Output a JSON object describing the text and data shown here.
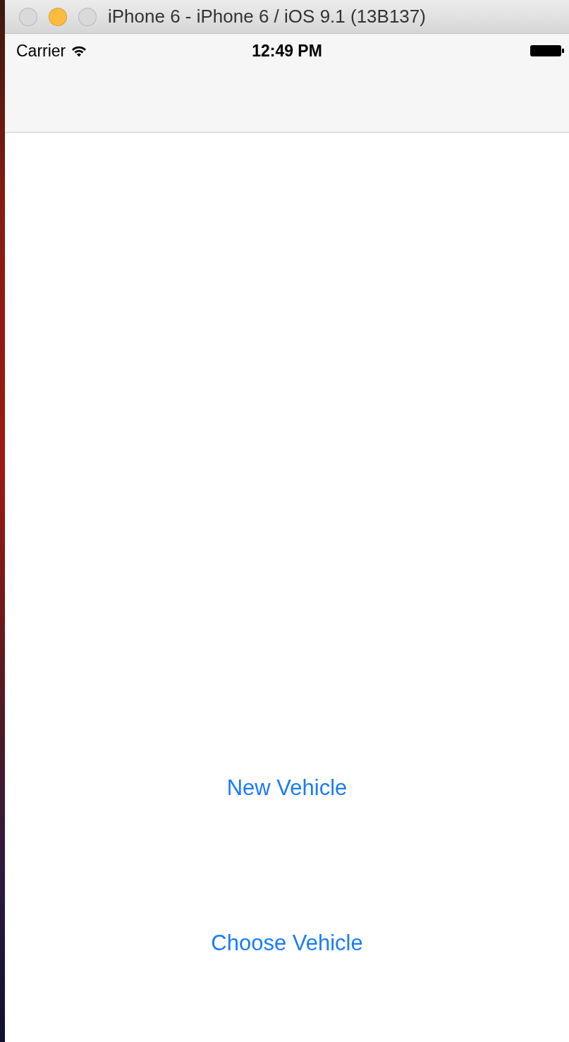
{
  "window": {
    "title": "iPhone 6 - iPhone 6 / iOS 9.1 (13B137)",
    "traffic_lights": [
      {
        "color": "#d9d9d9"
      },
      {
        "color": "#fdbc40"
      },
      {
        "color": "#d9d9d9"
      }
    ]
  },
  "status_bar": {
    "carrier": "Carrier",
    "time": "12:49 PM"
  },
  "buttons": [
    {
      "label": "New Vehicle"
    },
    {
      "label": "Choose Vehicle"
    }
  ]
}
